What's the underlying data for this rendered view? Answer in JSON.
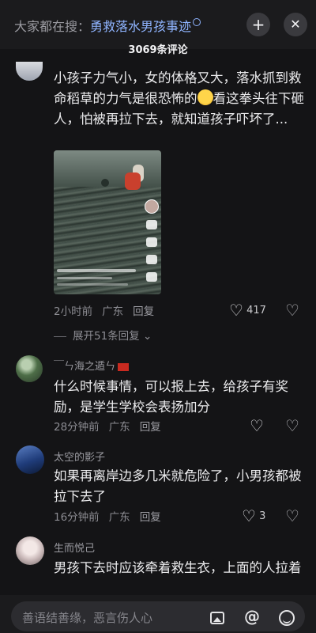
{
  "header": {
    "search_prefix": "大家都在搜：",
    "search_keyword": "勇救落水男孩事迹",
    "comment_count_title": "3069条评论"
  },
  "comments": [
    {
      "text_before_emoji": "小孩子力气小，女的体格又大，落水抓到救命稻草的力气是很恐怖的",
      "emoji": "flushed-face",
      "text_after_emoji": "看这拳头往下砸人，怕被再拉下去，就知道孩子吓坏了...",
      "time": "2小时前",
      "location": "广东",
      "reply_label": "回复",
      "likes": "417",
      "expand_label": "展开51条回复"
    },
    {
      "username": "￣ㄣ海之遁ㄣ",
      "text": "什么时候事情，可以报上去，给孩子有奖励，是学生学校会表扬加分",
      "time": "28分钟前",
      "location": "广东",
      "reply_label": "回复",
      "likes": ""
    },
    {
      "username": "太空的影子",
      "text": "如果再离岸边多几米就危险了，小男孩都被拉下去了",
      "time": "16分钟前",
      "location": "广东",
      "reply_label": "回复",
      "likes": "3"
    },
    {
      "username": "生而悦己",
      "text": "男孩下去时应该牵着救生衣，上面的人拉着"
    }
  ],
  "input": {
    "placeholder": "善语结善缘，恶言伤人心"
  },
  "icons": {
    "plus": "plus-icon",
    "close": "close-icon",
    "like": "heart-icon",
    "dislike": "broken-heart-icon",
    "chevron": "chevron-down-icon",
    "image": "image-icon",
    "mention": "at-icon",
    "emoji": "emoji-icon"
  },
  "colors": {
    "background": "#141416",
    "keyword": "#8fb4ff",
    "flag": "#c82a20"
  }
}
